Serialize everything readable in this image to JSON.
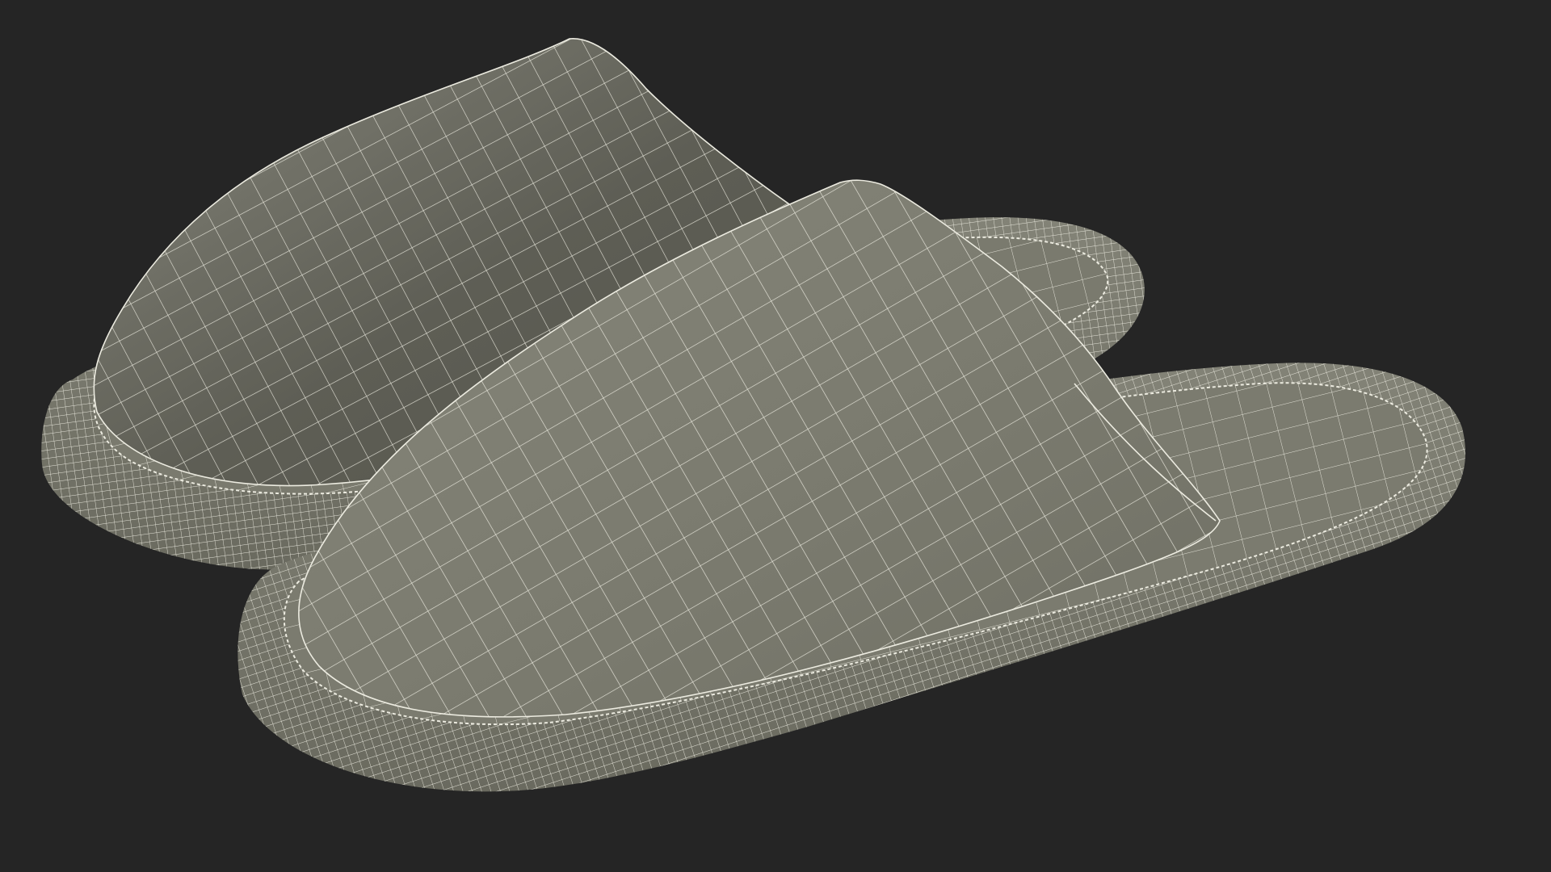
{
  "scene": {
    "subject": "pair-of-slippers-wireframe",
    "background_color": "#252525",
    "surface_color": "#7c7c70",
    "surface_shadow_color": "#4e4e45",
    "surface_highlight_color": "#8a8a7d",
    "wire_color": "#ecebe0",
    "objects": [
      {
        "name": "back-slipper"
      },
      {
        "name": "front-slipper"
      }
    ]
  }
}
